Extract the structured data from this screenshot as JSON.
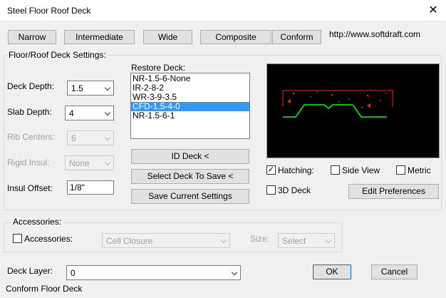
{
  "window": {
    "title": "Steel Floor Roof Deck",
    "close_glyph": "✕"
  },
  "top_buttons": {
    "narrow": "Narrow",
    "intermediate": "Intermediate",
    "wide": "Wide",
    "composite": "Composite",
    "conform": "Conform"
  },
  "url": "http://www.softdraft.com",
  "settings": {
    "group_label": "Floor/Roof Deck Settings:",
    "deck_depth": {
      "label": "Deck Depth:",
      "value": "1.5"
    },
    "slab_depth": {
      "label": "Slab Depth:",
      "value": "4"
    },
    "rib_centers": {
      "label": "Rib Centers:",
      "value": "6"
    },
    "rigid_insul": {
      "label": "Rigid Insul:",
      "value": "None"
    },
    "insul_offset": {
      "label": "Insul Offset:",
      "value": "1/8\""
    }
  },
  "restore_deck": {
    "label": "Restore Deck:",
    "items": [
      "NR-1.5-6-None",
      "IR-2-8-2",
      "WR-3-9-3.5",
      "CFD-1.5-4-0",
      "NR-1.5-6-1"
    ],
    "selected_index": 3
  },
  "action_buttons": {
    "id_deck": "ID Deck <",
    "select_deck": "Select Deck To Save <",
    "save_settings": "Save Current Settings"
  },
  "options": {
    "hatching": {
      "label": "Hatching:",
      "checked": true
    },
    "side_view": {
      "label": "Side View",
      "checked": false
    },
    "metric": {
      "label": "Metric",
      "checked": false
    },
    "deck_3d": {
      "label": "3D Deck",
      "checked": false
    },
    "edit_preferences": "Edit Preferences"
  },
  "accessories": {
    "group_label": "Accessories:",
    "checkbox_label": "Accessories:",
    "checked": false,
    "type_value": "Cell Closure",
    "size_label": "Size:",
    "size_value": "Select"
  },
  "deck_layer": {
    "label": "Deck Layer:",
    "value": "0"
  },
  "footer": {
    "ok": "OK",
    "cancel": "Cancel",
    "status": "Conform Floor Deck"
  },
  "colors": {
    "preview_bg": "#000000",
    "deck_profile": "#00ff00",
    "hatch": "#ff0000",
    "selection": "#3399ff"
  }
}
